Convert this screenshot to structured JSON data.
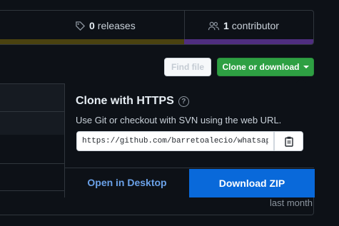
{
  "stats": {
    "releases_count": "0",
    "releases_label": "releases",
    "contributors_count": "1",
    "contributors_label": "contributor"
  },
  "actions": {
    "find_file": "Find file",
    "clone_download": "Clone or download"
  },
  "clone_dropdown": {
    "title": "Clone with HTTPS",
    "description": "Use Git or checkout with SVN using the web URL.",
    "url": "https://github.com/barretoalecio/whatsap",
    "open_in_desktop": "Open in Desktop",
    "download_zip": "Download ZIP"
  },
  "file_list": {
    "last_commit_time": "last month"
  },
  "colors": {
    "accent_green": "#2ea043",
    "accent_blue": "#0969da",
    "background": "#0d1117"
  }
}
